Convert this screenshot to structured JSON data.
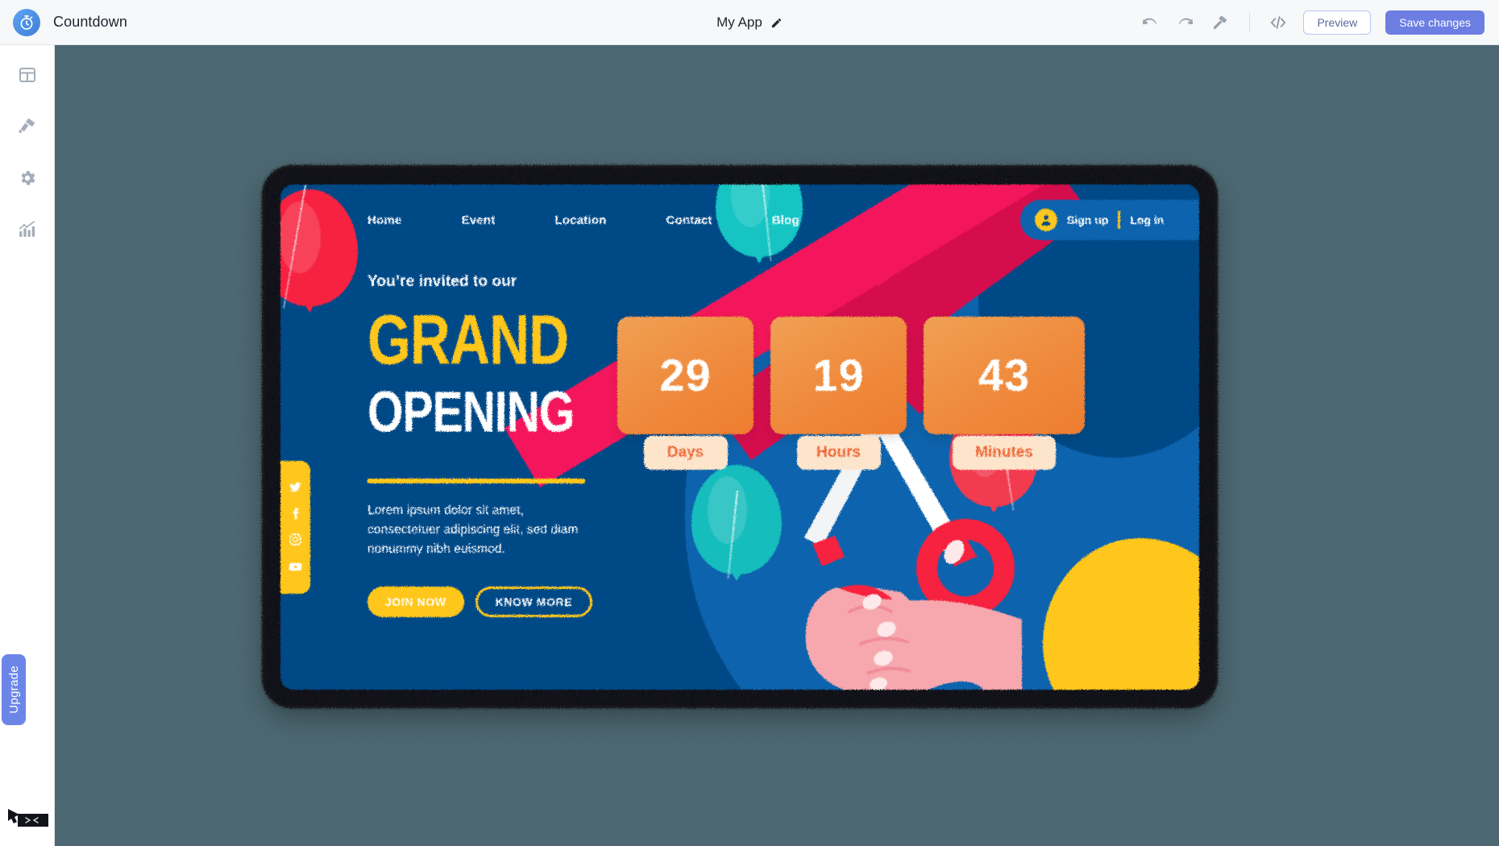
{
  "topbar": {
    "brand_name": "Countdown",
    "brand_icon": "stopwatch-icon",
    "doc_title": "My App",
    "edit_icon": "pencil-icon",
    "undo_icon": "undo-arrow-icon",
    "redo_icon": "redo-arrow-icon",
    "theme_icon": "paint-roller-icon",
    "code_icon": "code-brackets-icon",
    "preview_label": "Preview",
    "save_label": "Save changes",
    "accent_color": "#6c7ee1",
    "preview_border_color": "#b9c5f2"
  },
  "rail": {
    "items": [
      {
        "name": "layout",
        "icon": "layout-grid-icon"
      },
      {
        "name": "design",
        "icon": "paint-brush-icon"
      },
      {
        "name": "settings",
        "icon": "gear-icon"
      },
      {
        "name": "analytics",
        "icon": "bar-chart-icon"
      }
    ],
    "upgrade_label": "Upgrade",
    "upgrade_color": "#6c86e8",
    "cursor_icon": "cursor-badge-icon"
  },
  "canvas": {
    "background_color": "#4d6872",
    "device_frame_color": "#15181c"
  },
  "site": {
    "theme": {
      "navy": "#034a87",
      "blue": "#0a63ad",
      "yellow": "#ffc71e",
      "pink": "#f4145b",
      "pink_dark": "#d60c4e",
      "teal": "#14c4c4",
      "red": "#f6233f",
      "orange_card_top": "#f0a055",
      "orange_card_bottom": "#ee7d30",
      "pill_bg": "#fde5cc",
      "pill_text": "#ee6a3a"
    },
    "nav": {
      "links": [
        {
          "label": "Home"
        },
        {
          "label": "Event"
        },
        {
          "label": "Location"
        },
        {
          "label": "Contact"
        },
        {
          "label": "Blog"
        }
      ],
      "avatar_icon": "user-avatar-icon",
      "signup_label": "Sign up",
      "login_label": "Log in"
    },
    "hero": {
      "eyebrow": "You’re invited to our",
      "title_line1": "GRAND",
      "title_line2": "OPENING",
      "paragraph": "Lorem ipsum dolor sit amet, consectetuer adipiscing elit, sed diam nonummy nibh euismod.",
      "cta_primary": "JOIN NOW",
      "cta_secondary": "KNOW MORE"
    },
    "social": [
      {
        "name": "twitter",
        "icon": "twitter-icon"
      },
      {
        "name": "facebook",
        "icon": "facebook-icon"
      },
      {
        "name": "instagram",
        "icon": "instagram-icon"
      },
      {
        "name": "youtube",
        "icon": "youtube-icon"
      }
    ],
    "countdown": [
      {
        "value": "29",
        "label": "Days"
      },
      {
        "value": "19",
        "label": "Hours"
      },
      {
        "value": "43",
        "label": "Minutes"
      }
    ],
    "illustration": {
      "scene": "grand-opening-ribbon-cutting",
      "elements": [
        "red-balloon",
        "teal-balloon",
        "yellow-balloon",
        "pink-ribbon",
        "scissors",
        "hand"
      ]
    }
  }
}
